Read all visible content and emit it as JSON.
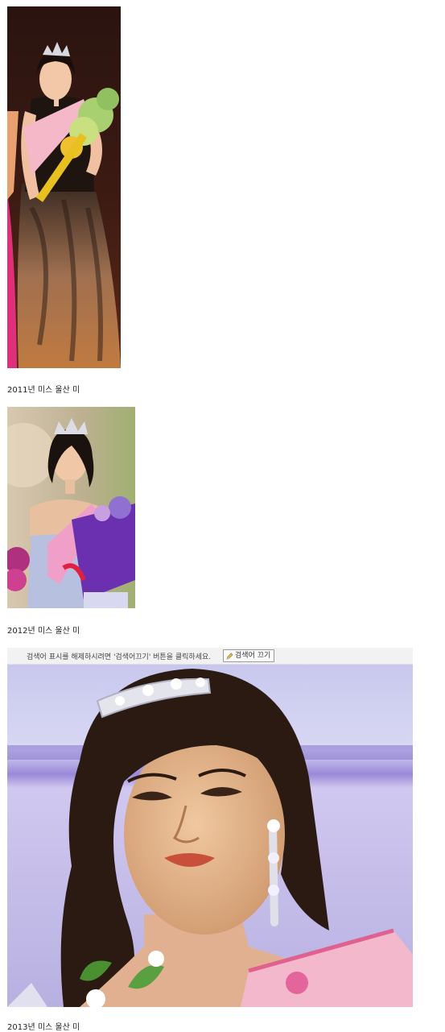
{
  "entries": [
    {
      "caption": "2011년 미스 울산 미",
      "photo_alt": "2011 winner photo"
    },
    {
      "caption": "2012년 미스 울산 미",
      "photo_alt": "2012 winner photo"
    },
    {
      "caption": "2013년 미스 울산 미",
      "photo_alt": "2013 winner photo"
    }
  ],
  "search_bar": {
    "message": "검색어 표시를 해제하시려면 '검색어끄기' 버튼을 클릭하세요.",
    "button_label": "검색어 끄기"
  }
}
